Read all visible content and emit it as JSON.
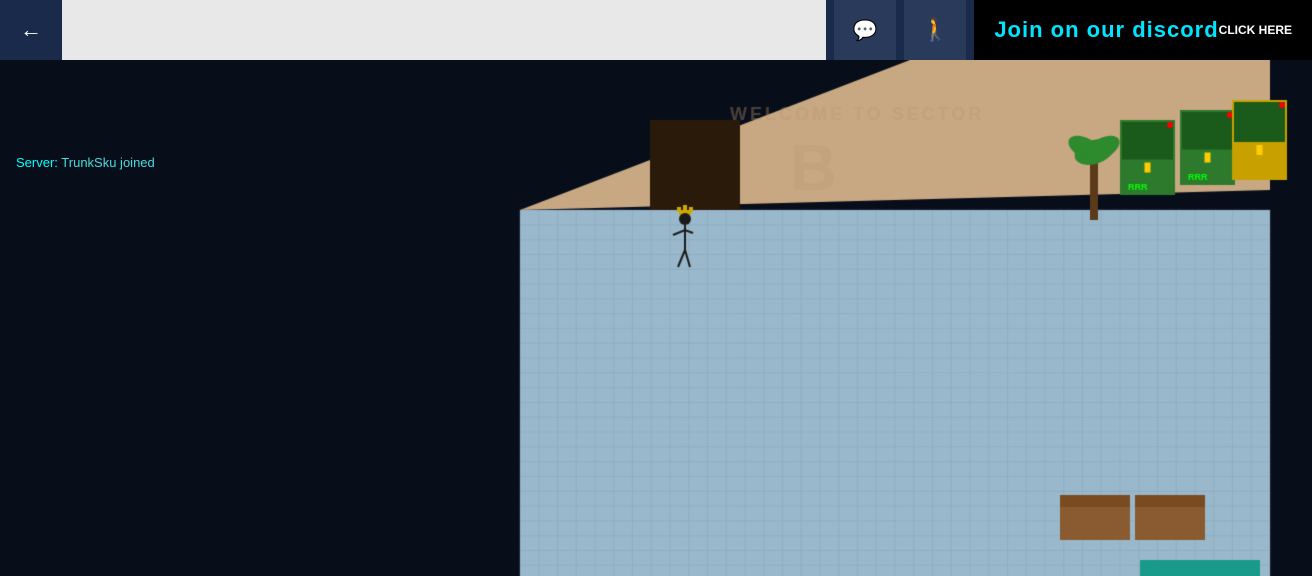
{
  "topbar": {
    "back_label": "←",
    "search_placeholder": "",
    "discord_text": "Join on our discord",
    "click_here": "CLICK\nHERE"
  },
  "server": {
    "label": "Server:",
    "message": "TrunkSku joined"
  },
  "game": {
    "sector_text": "WELCOME TO SECTOR B",
    "floor_color": "#a8c4d8",
    "wall_color": "#c8a882",
    "grid_color": "#8bafc4"
  },
  "icons": {
    "back": "←",
    "chat": "💬",
    "emote": "🚶"
  }
}
